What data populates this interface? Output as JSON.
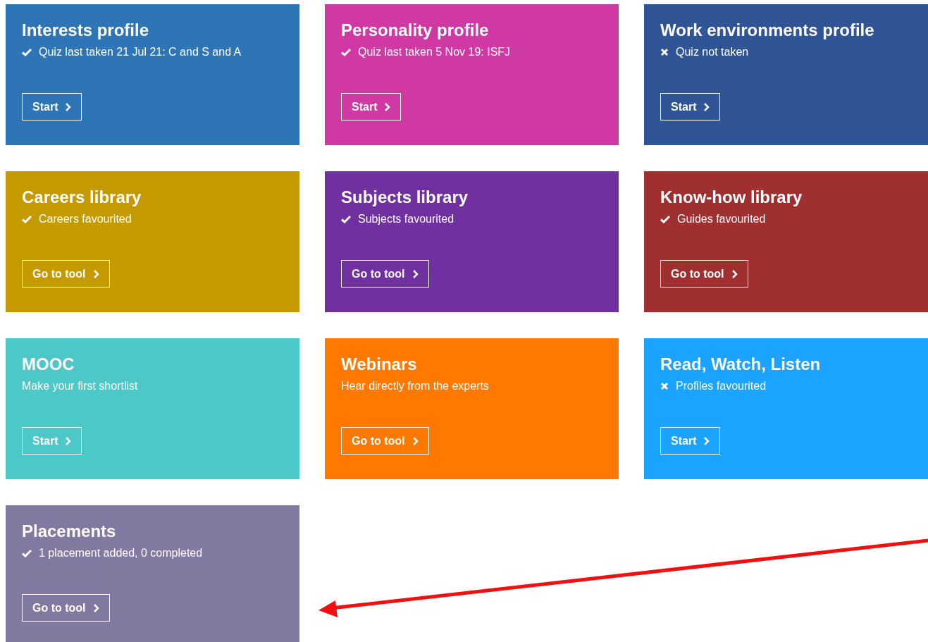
{
  "cards": [
    {
      "title": "Interests profile",
      "checked": true,
      "subtitle": "Quiz last taken 21 Jul 21: C and S and A",
      "button": "Start",
      "color": "#2e75b6"
    },
    {
      "title": "Personality profile",
      "checked": true,
      "subtitle": "Quiz last taken 5 Nov 19: ISFJ",
      "button": "Start",
      "color": "#d038a4"
    },
    {
      "title": "Work environments profile",
      "checked": false,
      "subtitle": "Quiz not taken",
      "button": "Start",
      "color": "#2f5597"
    },
    {
      "title": "Careers library",
      "checked": true,
      "subtitle": "Careers favourited",
      "button": "Go to tool",
      "color": "#c49a00"
    },
    {
      "title": "Subjects library",
      "checked": true,
      "subtitle": "Subjects favourited",
      "button": "Go to tool",
      "color": "#7030a0"
    },
    {
      "title": "Know-how library",
      "checked": true,
      "subtitle": "Guides favourited",
      "button": "Go to tool",
      "color": "#a03030"
    },
    {
      "title": "MOOC",
      "subtitle": "Make your first shortlist",
      "button": "Start",
      "color": "#4cc8c8"
    },
    {
      "title": "Webinars",
      "subtitle": "Hear directly from the experts",
      "button": "Go to tool",
      "color": "#ff7800"
    },
    {
      "title": "Read, Watch, Listen",
      "checked": false,
      "subtitle": "Profiles favourited",
      "button": "Start",
      "color": "#1aa3ff"
    },
    {
      "title": "Placements",
      "checked": true,
      "subtitle": "1 placement added, 0 completed",
      "button": "Go to tool",
      "color": "#8279a0"
    }
  ]
}
